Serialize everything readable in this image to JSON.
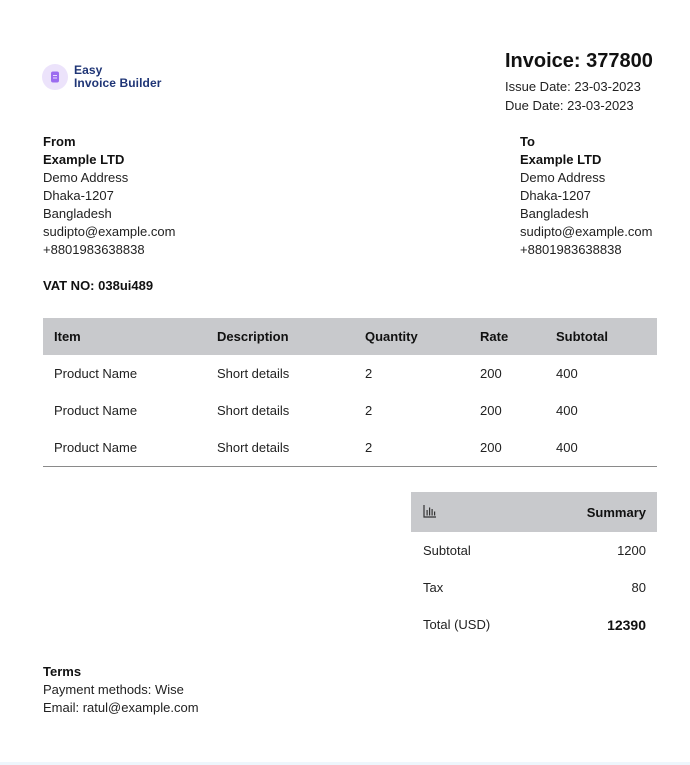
{
  "logo": {
    "line1": "Easy",
    "line2": "Invoice Builder",
    "icon": "document-icon",
    "accent": "#9b6cf0",
    "brand_color": "#1f3576"
  },
  "invoice": {
    "title": "Invoice: 377800",
    "issue_date": "Issue Date: 23-03-2023",
    "due_date": "Due Date: 23-03-2023"
  },
  "from": {
    "label": "From",
    "company": "Example LTD",
    "address": "Demo Address",
    "city": "Dhaka-1207",
    "country": "Bangladesh",
    "email": "sudipto@example.com",
    "phone": "+8801983638838"
  },
  "to": {
    "label": "To",
    "company": "Example LTD",
    "address": "Demo Address",
    "city": "Dhaka-1207",
    "country": "Bangladesh",
    "email": "sudipto@example.com",
    "phone": "+8801983638838"
  },
  "vat": "VAT NO: 038ui489",
  "items": {
    "headers": [
      "Item",
      "Description",
      "Quantity",
      "Rate",
      "Subtotal"
    ],
    "rows": [
      [
        "Product Name",
        "Short details",
        "2",
        "200",
        "400"
      ],
      [
        "Product Name",
        "Short details",
        "2",
        "200",
        "400"
      ],
      [
        "Product Name",
        "Short details",
        "2",
        "200",
        "400"
      ]
    ]
  },
  "summary": {
    "title": "Summary",
    "icon": "bar-chart-icon",
    "subtotal_label": "Subtotal",
    "subtotal_value": "1200",
    "tax_label": "Tax",
    "tax_value": "80",
    "total_label": "Total (USD)",
    "total_value": "12390"
  },
  "terms": {
    "label": "Terms",
    "payment": "Payment methods: Wise",
    "email": "Email: ratul@example.com"
  }
}
